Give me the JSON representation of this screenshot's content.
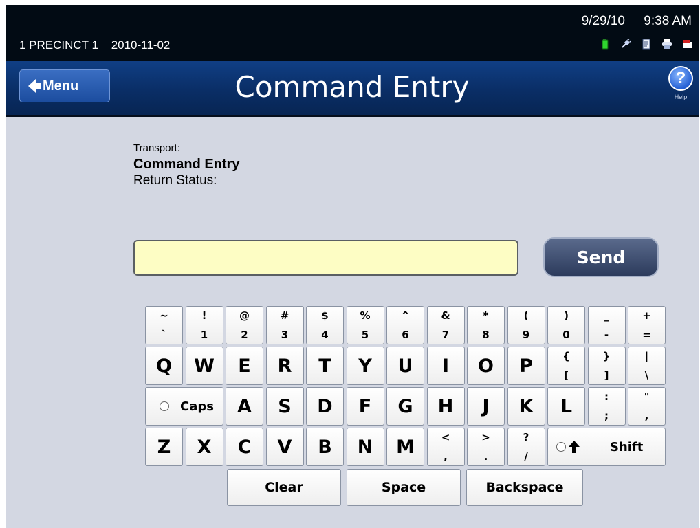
{
  "status_bar": {
    "precinct": "1 PRECINCT 1",
    "election_date": "2010-11-02",
    "date": "9/29/10",
    "time": "9:38 AM",
    "icons": [
      "battery-icon",
      "power-plug-icon",
      "document-icon",
      "printer-icon",
      "card-icon"
    ]
  },
  "title_bar": {
    "menu_label": "Menu",
    "title": "Command Entry",
    "help_glyph": "?",
    "help_label": "Help"
  },
  "info": {
    "transport_label": "Transport:",
    "transport_value": "Command Entry",
    "return_status_label": "Return Status:"
  },
  "command": {
    "value": "",
    "placeholder": "",
    "send_label": "Send"
  },
  "keyboard": {
    "row1": [
      {
        "top": "~",
        "bottom": "`"
      },
      {
        "top": "!",
        "bottom": "1"
      },
      {
        "top": "@",
        "bottom": "2"
      },
      {
        "top": "#",
        "bottom": "3"
      },
      {
        "top": "$",
        "bottom": "4"
      },
      {
        "top": "%",
        "bottom": "5"
      },
      {
        "top": "^",
        "bottom": "6"
      },
      {
        "top": "&",
        "bottom": "7"
      },
      {
        "top": "*",
        "bottom": "8"
      },
      {
        "top": "(",
        "bottom": "9"
      },
      {
        "top": ")",
        "bottom": "0"
      },
      {
        "top": "_",
        "bottom": "-"
      },
      {
        "top": "+",
        "bottom": "="
      }
    ],
    "row2": [
      "Q",
      "W",
      "E",
      "R",
      "T",
      "Y",
      "U",
      "I",
      "O",
      "P"
    ],
    "row2_dual": [
      {
        "top": "{",
        "bottom": "["
      },
      {
        "top": "}",
        "bottom": "]"
      },
      {
        "top": "|",
        "bottom": "\\"
      }
    ],
    "caps_label": "Caps",
    "row3": [
      "A",
      "S",
      "D",
      "F",
      "G",
      "H",
      "J",
      "K",
      "L"
    ],
    "row3_dual": [
      {
        "top": ":",
        "bottom": ";"
      },
      {
        "top": "\"",
        "bottom": ","
      }
    ],
    "row4": [
      "Z",
      "X",
      "C",
      "V",
      "B",
      "N",
      "M"
    ],
    "row4_dual": [
      {
        "top": "<",
        "bottom": ","
      },
      {
        "top": ">",
        "bottom": "."
      },
      {
        "top": "?",
        "bottom": "/"
      }
    ],
    "shift_label": "Shift",
    "clear_label": "Clear",
    "space_label": "Space",
    "backspace_label": "Backspace"
  }
}
